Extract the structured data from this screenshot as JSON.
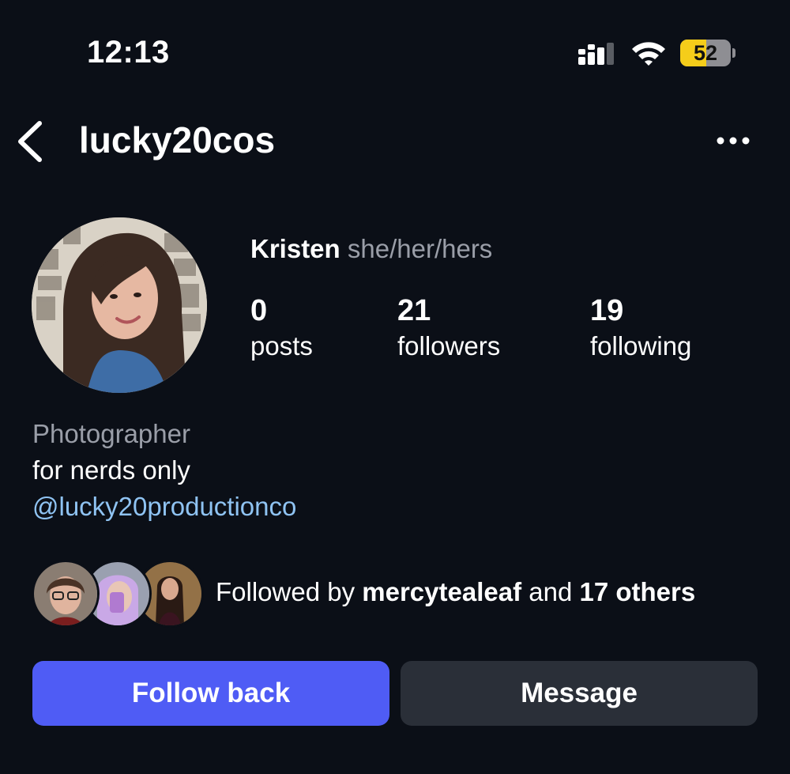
{
  "status_bar": {
    "time": "12:13",
    "battery_level": "52",
    "battery_fraction": 0.52,
    "signal_icon": "cellular-signal-icon",
    "wifi_icon": "wifi-icon"
  },
  "header": {
    "username": "lucky20cos",
    "back_icon": "chevron-left-icon",
    "more_icon": "more-dots-icon"
  },
  "profile": {
    "name": "Kristen",
    "pronouns": "she/her/hers",
    "stats": [
      {
        "value": "0",
        "label": "posts"
      },
      {
        "value": "21",
        "label": "followers"
      },
      {
        "value": "19",
        "label": "following"
      }
    ]
  },
  "bio": {
    "category": "Photographer",
    "text": "for nerds only",
    "link": "@lucky20productionco"
  },
  "followed_by": {
    "prefix": "Followed by ",
    "user": "mercytealeaf",
    "middle": " and ",
    "others": "17 others"
  },
  "actions": {
    "follow_label": "Follow back",
    "message_label": "Message"
  },
  "colors": {
    "background": "#0b0f17",
    "follow_button": "#4f5cf5",
    "message_button": "#2a2f38",
    "link": "#8fc3f2",
    "muted_text": "#9a9ea8",
    "battery": "#f5cd1a"
  }
}
